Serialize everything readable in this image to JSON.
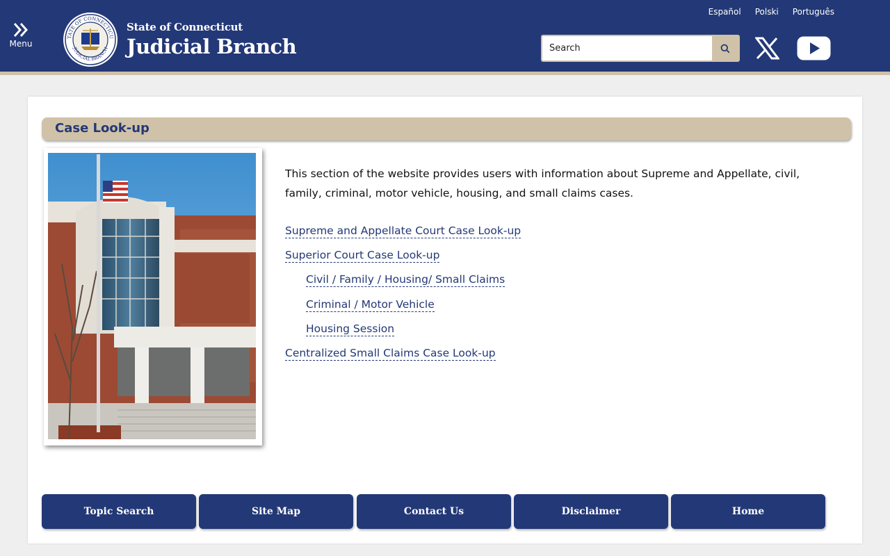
{
  "header": {
    "menu_label": "Menu",
    "brand_small": "State of Connecticut",
    "brand_big": "Judicial Branch",
    "seal_text_top": "STATE OF CONNECTICUT",
    "seal_text_bottom": "JUDICIAL BRANCH",
    "languages": [
      "Español",
      "Polski",
      "Português"
    ],
    "search_placeholder": "Search",
    "social": [
      "x-icon",
      "youtube-icon"
    ],
    "colors": {
      "navy": "#233876",
      "tan": "#d0c2a8"
    }
  },
  "main": {
    "heading": "Case Look-up",
    "intro": "This section of the website provides users with information about Supreme and Appellate, civil, family, criminal, motor vehicle, housing, and small claims cases.",
    "links": [
      {
        "label": "Supreme and Appellate Court Case Look-up",
        "level": 0
      },
      {
        "label": "Superior Court Case Look-up",
        "level": 0
      },
      {
        "label": "Civil / Family / Housing/ Small Claims",
        "level": 1
      },
      {
        "label": "Criminal / Motor Vehicle",
        "level": 1
      },
      {
        "label": "Housing Session",
        "level": 1
      },
      {
        "label": "Centralized Small Claims Case Look-up",
        "level": 0
      }
    ]
  },
  "footer": {
    "buttons": [
      "Topic Search",
      "Site Map",
      "Contact Us",
      "Disclaimer",
      "Home"
    ]
  }
}
